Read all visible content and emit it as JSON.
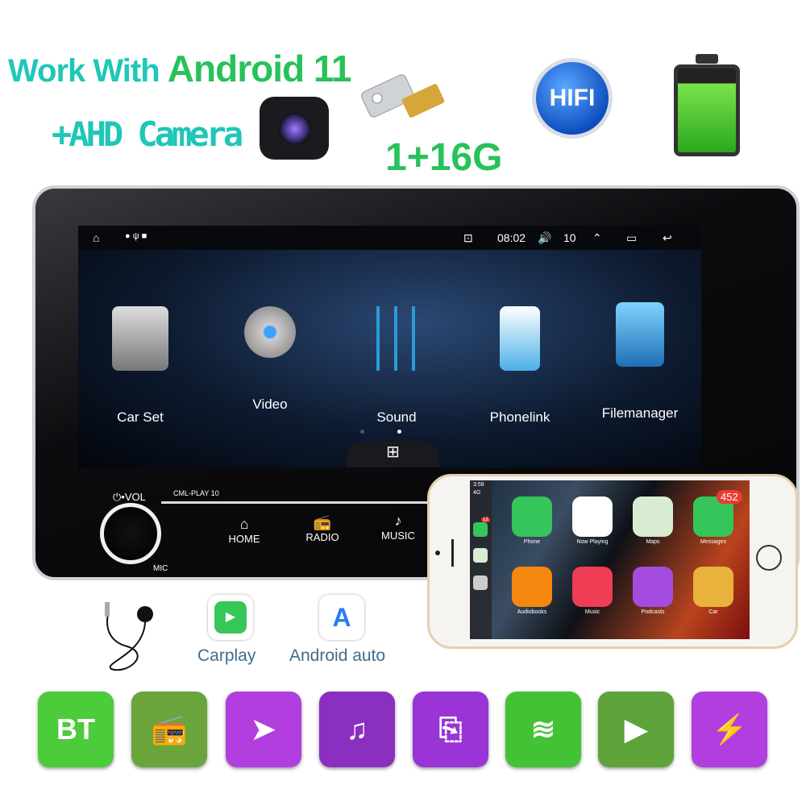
{
  "headline": {
    "work_with": "Work With",
    "android": "Android 11",
    "camera": "+AHD Camera",
    "memory": "1+16G",
    "hifi": "HIFI"
  },
  "statusbar": {
    "time": "08:02",
    "volume": "10"
  },
  "apps": [
    {
      "label": "Car Set"
    },
    {
      "label": "Video"
    },
    {
      "label": "Sound"
    },
    {
      "label": "Phonelink"
    },
    {
      "label": "Filemanager"
    }
  ],
  "panel": {
    "vol": "⏻•VOL",
    "model": "CML-PLAY 10",
    "mic": "MIC",
    "buttons": [
      {
        "label": "HOME",
        "icon": "⌂"
      },
      {
        "label": "RADIO",
        "icon": "📻"
      },
      {
        "label": "MUSIC",
        "icon": "♪"
      }
    ]
  },
  "phone": {
    "time": "3:58",
    "network": "4G",
    "side_badge": "12",
    "apps": [
      {
        "label": "Phone",
        "color": "#35c55a"
      },
      {
        "label": "Now Playing",
        "color": "#ffffff"
      },
      {
        "label": "Maps",
        "color": "#d8ecd2"
      },
      {
        "label": "Messages",
        "color": "#35c55a",
        "badge": "452"
      },
      {
        "label": "Audiobooks",
        "color": "#f7880f"
      },
      {
        "label": "Music",
        "color": "#ee3d55"
      },
      {
        "label": "Podcasts",
        "color": "#a44be0"
      },
      {
        "label": "Car",
        "color": "#e9b23a"
      }
    ]
  },
  "accessories": {
    "carplay": "Carplay",
    "android_auto": "Android auto"
  },
  "features": [
    {
      "icon": "bluetooth-icon",
      "glyph": "BT",
      "color": "#4ccb3b"
    },
    {
      "icon": "radio-icon",
      "glyph": "📻",
      "color": "#6aa53c"
    },
    {
      "icon": "navigation-icon",
      "glyph": "➤",
      "color": "#b23ee0"
    },
    {
      "icon": "music-icon",
      "glyph": "♫",
      "color": "#8a2fc0"
    },
    {
      "icon": "usb-icon",
      "glyph": "⎘",
      "color": "#9a34d6"
    },
    {
      "icon": "wifi-icon",
      "glyph": "≋",
      "color": "#44c236"
    },
    {
      "icon": "play-icon",
      "glyph": "▶",
      "color": "#5ea33a"
    },
    {
      "icon": "battery-charge-icon",
      "glyph": "⚡",
      "color": "#b23ee0"
    }
  ]
}
